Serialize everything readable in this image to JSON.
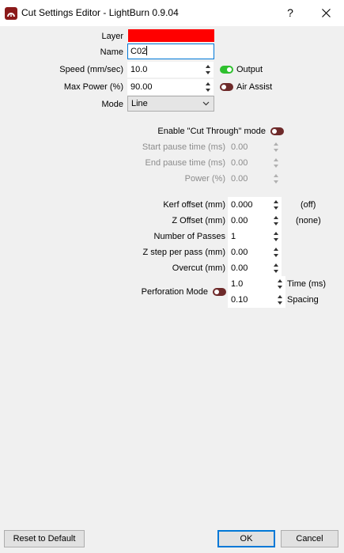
{
  "window": {
    "title": "Cut Settings Editor - LightBurn 0.9.04",
    "help_label": "?"
  },
  "colors": {
    "layer_color": "#ff0000",
    "toggle_on": "#2ec02e",
    "toggle_off": "#6e2a2a",
    "accent": "#0078d7"
  },
  "icons": {
    "app": "lightburn-logo-icon",
    "close": "close-icon",
    "help": "help-icon"
  },
  "layer": {
    "label": "Layer"
  },
  "name": {
    "label": "Name",
    "value": "C02"
  },
  "speed": {
    "label": "Speed (mm/sec)",
    "value": "10.0"
  },
  "output": {
    "label": "Output",
    "state": "on"
  },
  "max_power": {
    "label": "Max Power (%)",
    "value": "90.00"
  },
  "air_assist": {
    "label": "Air Assist",
    "state": "off"
  },
  "mode": {
    "label": "Mode",
    "value": "Line"
  },
  "cut_through": {
    "label": "Enable \"Cut Through\" mode",
    "state": "off",
    "start_pause": {
      "label": "Start pause time (ms)",
      "value": "0.00"
    },
    "end_pause": {
      "label": "End pause time (ms)",
      "value": "0.00"
    },
    "power": {
      "label": "Power (%)",
      "value": "0.00"
    }
  },
  "kerf": {
    "label": "Kerf offset (mm)",
    "value": "0.000",
    "note": "(off)"
  },
  "z_offset": {
    "label": "Z Offset (mm)",
    "value": "0.00",
    "note": "(none)"
  },
  "passes": {
    "label": "Number of Passes",
    "value": "1"
  },
  "z_step": {
    "label": "Z step per pass (mm)",
    "value": "0.00"
  },
  "overcut": {
    "label": "Overcut (mm)",
    "value": "0.00"
  },
  "perforation": {
    "label": "Perforation Mode",
    "state": "off",
    "time": {
      "value": "1.0",
      "label": "Time (ms)"
    },
    "spacing": {
      "value": "0.10",
      "label": "Spacing"
    }
  },
  "buttons": {
    "reset": "Reset to Default",
    "ok": "OK",
    "cancel": "Cancel"
  }
}
